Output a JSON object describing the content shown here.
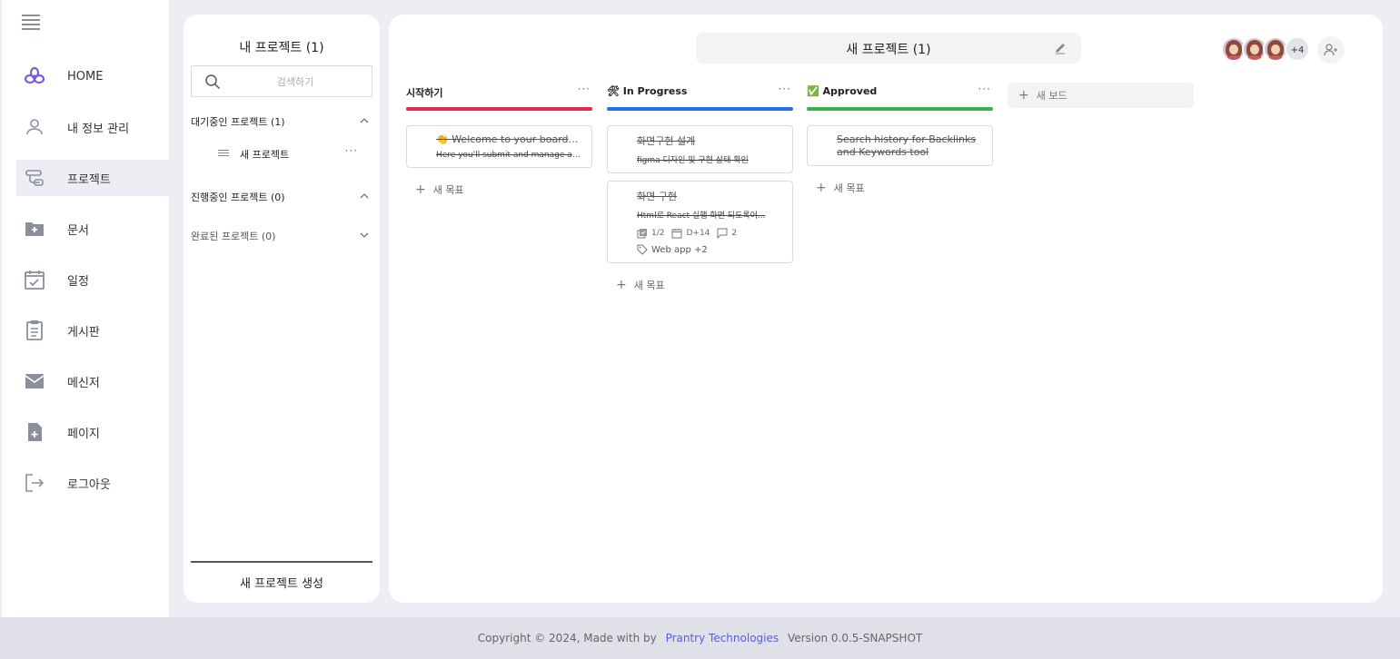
{
  "nav": {
    "items": [
      {
        "label": "HOME",
        "icon": "flower-logo-icon"
      },
      {
        "label": "내 정보 관리",
        "icon": "user-icon"
      },
      {
        "label": "프로젝트",
        "icon": "project-icon"
      },
      {
        "label": "문서",
        "icon": "folder-add-icon"
      },
      {
        "label": "일정",
        "icon": "calendar-check-icon"
      },
      {
        "label": "게시판",
        "icon": "clipboard-icon"
      },
      {
        "label": "메신저",
        "icon": "mail-icon"
      },
      {
        "label": "페이지",
        "icon": "file-add-icon"
      },
      {
        "label": "로그아웃",
        "icon": "logout-icon"
      }
    ],
    "active_index": 2
  },
  "project_list": {
    "title": "내 프로젝트 (1)",
    "search_placeholder": "검색하기",
    "sections": [
      {
        "label": "대기중인 프로젝트 (1)",
        "expanded": true
      },
      {
        "label": "진행중인 프로젝트 (0)",
        "expanded": true
      },
      {
        "label": "완료된 프로젝트 (0)",
        "expanded": false
      }
    ],
    "waiting_items": [
      {
        "name": "새 프로젝트",
        "more": "···"
      }
    ],
    "create_label": "새 프로젝트 생성"
  },
  "board": {
    "title": "새 프로젝트 (1)",
    "avatars_more": "+4",
    "add_board_label": "새 보드",
    "add_goal_label": "새 목표",
    "columns": [
      {
        "title": "시작하기",
        "color": "#e0294f",
        "more": "···",
        "cards": [
          {
            "title": "👏 Welcome to your board 👉",
            "desc": "Here you'll submit and manage all..."
          }
        ]
      },
      {
        "title": "🛠 In Progress",
        "color": "#1f6fe0",
        "more": "···",
        "cards": [
          {
            "title": "화면구현 설계",
            "desc": "figma 디자인 및 구현 상태 확인"
          },
          {
            "title": "화면 구현",
            "desc": "Html로 React 실행 화면 되도록어...",
            "checklist": "1/2",
            "due": "D+14",
            "comments": "2",
            "tags": "Web app",
            "tags_more": "+2"
          }
        ]
      },
      {
        "title": "✅ Approved",
        "color": "#35b44a",
        "more": "···",
        "cards": [
          {
            "title": "Search history for Backlinks",
            "title2": "and Keywords tool"
          }
        ]
      }
    ]
  },
  "footer": {
    "copyright": "Copyright © 2024, Made with  by",
    "company": "Prantry Technologies",
    "version": "Version 0.0.5-SNAPSHOT"
  }
}
